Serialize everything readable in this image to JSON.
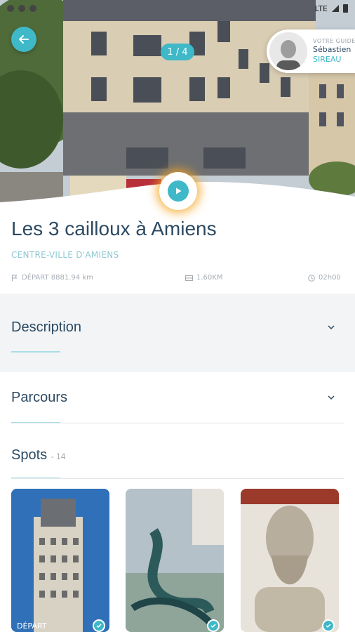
{
  "status_bar": {
    "network": "LTE"
  },
  "hero": {
    "counter": "1 / 4"
  },
  "guide": {
    "caption": "VOTRE GUIDE",
    "first_name": "Sébastien",
    "last_name": "SIREAU"
  },
  "tour": {
    "title": "Les 3 cailloux à Amiens",
    "location": "CENTRE-VILLE D'AMIENS",
    "departure": "DÉPART 8881.94 km",
    "distance": "1.60KM",
    "duration": "02h00"
  },
  "sections": {
    "description": "Description",
    "parcours": "Parcours",
    "spots": "Spots",
    "spots_count": "- 14"
  },
  "spots": [
    {
      "label": "DÉPART",
      "visited": true
    },
    {
      "label": "",
      "visited": true
    },
    {
      "label": "",
      "visited": true
    }
  ],
  "colors": {
    "accent": "#3fb8c8",
    "title": "#2c4a63",
    "highlight": "#f5a623"
  },
  "icons": [
    "back-arrow-icon",
    "play-icon",
    "flag-icon",
    "distance-icon",
    "clock-icon",
    "chevron-down-icon",
    "check-icon"
  ]
}
